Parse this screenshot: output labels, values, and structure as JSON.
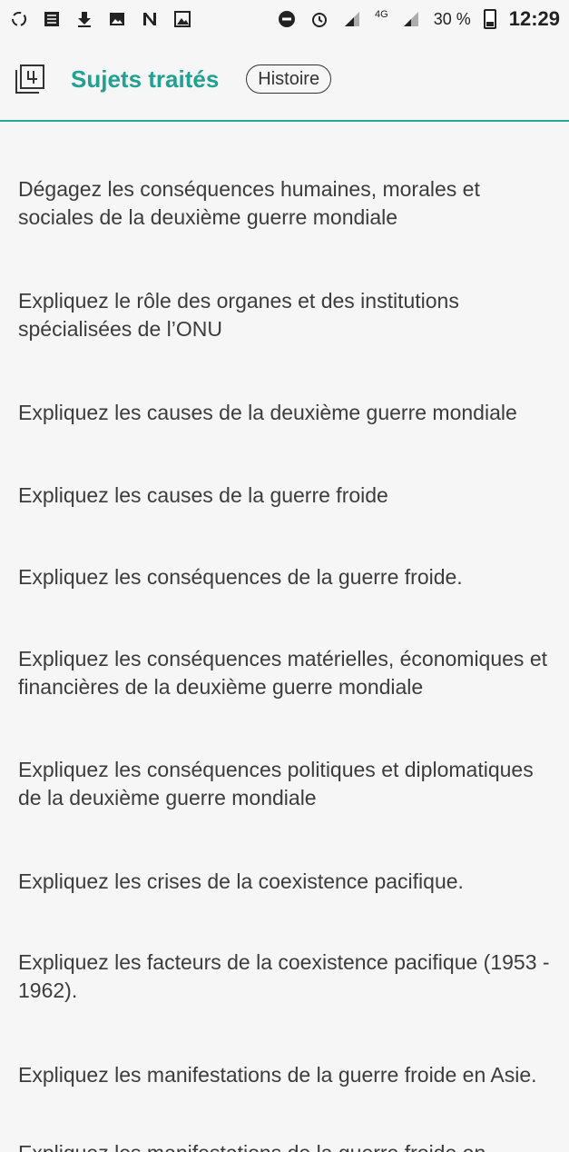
{
  "status_bar": {
    "battery_percent": "30 %",
    "time": "12:29",
    "network_label": "4G"
  },
  "header": {
    "icon": "book-number-icon",
    "title": "Sujets traités",
    "chip_label": "Histoire"
  },
  "colors": {
    "accent": "#22a091",
    "divider": "#2aa79b",
    "background": "#f6f6f6",
    "text": "#3c3c3c"
  },
  "subjects": [
    "Dégagez les conséquences humaines, morales et sociales de la deuxième guerre mondiale",
    "Expliquez le rôle des organes et des institutions spécialisées de  l’ONU",
    "Expliquez les causes de la deuxième guerre mondiale",
    "Expliquez les causes de la guerre froide",
    "Expliquez les conséquences de la guerre froide.",
    "Expliquez les conséquences matérielles, économiques et financières de la deuxième guerre mondiale",
    "Expliquez les conséquences politiques et diplomatiques de la deuxième guerre mondiale",
    "Expliquez les crises de la coexistence pacifique.",
    "Expliquez les facteurs de la coexistence pacifique (1953 - 1962).",
    "Expliquez les manifestations de la guerre froide en Asie.",
    "Expliquez les manifestations de la guerre froide en Europe"
  ]
}
